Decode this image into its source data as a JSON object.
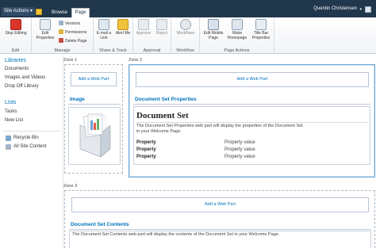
{
  "topbar": {
    "site_actions": "Site Actions",
    "site_actions_caret": "▾",
    "tabs": [
      {
        "label": "Browse"
      },
      {
        "label": "Page"
      }
    ],
    "user_name": "Quentin Christensen",
    "user_caret": "▾"
  },
  "ribbon": {
    "groups": [
      {
        "label": "Edit",
        "buttons": [
          {
            "label": "Stop Editing",
            "icon": "stop-editing-icon"
          }
        ]
      },
      {
        "label": "Manage",
        "buttons": [
          {
            "label": "Edit Properties",
            "icon": "edit-properties-icon"
          },
          {
            "label": "Versions",
            "icon": "versions-icon"
          },
          {
            "label": "Permissions",
            "icon": "permissions-icon"
          },
          {
            "label": "Delete Page",
            "icon": "delete-page-icon"
          }
        ]
      },
      {
        "label": "Share & Track",
        "buttons": [
          {
            "label": "E-mail a Link",
            "icon": "email-link-icon"
          },
          {
            "label": "Alert Me",
            "icon": "alert-me-icon"
          }
        ]
      },
      {
        "label": "Approval",
        "buttons": [
          {
            "label": "Approve",
            "icon": "approve-icon"
          },
          {
            "label": "Reject",
            "icon": "reject-icon"
          }
        ]
      },
      {
        "label": "Workflow",
        "buttons": [
          {
            "label": "Workflows",
            "icon": "workflows-icon"
          }
        ]
      },
      {
        "label": "Page Actions",
        "buttons": [
          {
            "label": "Edit Mobile Page",
            "icon": "edit-mobile-page-icon"
          },
          {
            "label": "Make Homepage",
            "icon": "make-homepage-icon"
          },
          {
            "label": "Title Bar Properties",
            "icon": "title-bar-properties-icon"
          }
        ]
      }
    ]
  },
  "leftnav": {
    "libraries_heading": "Libraries",
    "libraries": [
      "Documents",
      "Images and Videos",
      "Drop Off Library"
    ],
    "lists_heading": "Lists",
    "lists": [
      "Tasks",
      "New List"
    ],
    "recycle_bin": "Recycle Bin",
    "all_site_content": "All Site Content"
  },
  "zones": {
    "zone1": {
      "label": "Zone 1",
      "add_web_part": "Add a Web Part",
      "image_title": "Image"
    },
    "zone2": {
      "label": "Zone 2",
      "add_web_part": "Add a Web Part",
      "web_part_title": "Document Set Properties",
      "doc_set_heading": "Document Set",
      "description": "The Document Set Properties web part will display the properties of the Document Set in your Welcome Page.",
      "properties": [
        {
          "label": "Property",
          "value": "Property value"
        },
        {
          "label": "Property",
          "value": "Property value"
        },
        {
          "label": "Property",
          "value": "Property value"
        }
      ]
    },
    "zone3": {
      "label": "Zone 3",
      "add_web_part": "Add a Web Part",
      "web_part_title": "Document Set Contents",
      "description": "The Document Set Contents web part will display the contents of the Document Set in your Welcome Page."
    }
  }
}
